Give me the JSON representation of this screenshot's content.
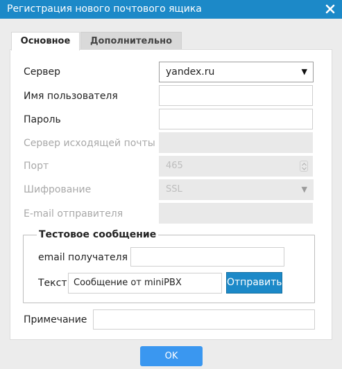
{
  "dialog": {
    "title": "Регистрация нового почтового ящика",
    "close_icon": "close-icon",
    "accent_color": "#1c89c8"
  },
  "tabs": [
    {
      "label": "Основное",
      "active": true
    },
    {
      "label": "Дополнительно",
      "active": false
    }
  ],
  "form": {
    "server": {
      "label": "Сервер",
      "value": "yandex.ru"
    },
    "username": {
      "label": "Имя пользователя",
      "value": ""
    },
    "password": {
      "label": "Пароль",
      "value": ""
    },
    "smtp_server": {
      "label": "Сервер исходящей почты",
      "value": "",
      "disabled": true
    },
    "port": {
      "label": "Порт",
      "value": "465",
      "disabled": true
    },
    "encryption": {
      "label": "Шифрование",
      "value": "SSL",
      "disabled": true
    },
    "sender_email": {
      "label": "E-mail отправителя",
      "value": "",
      "disabled": true
    }
  },
  "test_message": {
    "legend": "Тестовое сообщение",
    "recipient": {
      "label": "email получателя",
      "value": ""
    },
    "text": {
      "label": "Текст",
      "value": "Сообщение от miniPBX"
    },
    "send_label": "Отправить"
  },
  "note": {
    "label": "Примечание",
    "value": ""
  },
  "ok_label": "OK"
}
